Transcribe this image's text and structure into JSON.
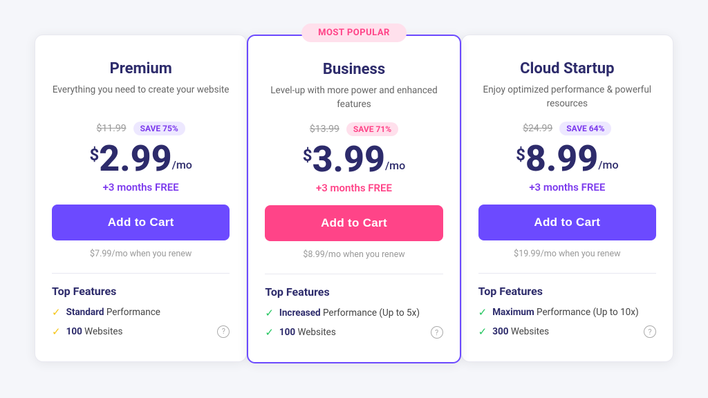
{
  "page": {
    "background": "#f5f6fa"
  },
  "plans": [
    {
      "id": "premium",
      "title": "Premium",
      "description": "Everything you need to create your website",
      "featured": false,
      "mostPopularLabel": "",
      "originalPrice": "$11.99",
      "saveBadge": "SAVE 75%",
      "saveBadgeStyle": "purple",
      "priceAmount": "2.99",
      "pricePeriod": "/mo",
      "freeMonths": "+3 months FREE",
      "freeMonthsStyle": "purple",
      "addToCartLabel": "Add to Cart",
      "addToCartStyle": "purple",
      "renewText": "$7.99/mo when you renew",
      "topFeaturesTitle": "Top Features",
      "features": [
        {
          "bold": "Standard",
          "rest": " Performance",
          "checkStyle": "yellow",
          "hasInfo": false
        },
        {
          "bold": "100",
          "rest": " Websites",
          "checkStyle": "yellow",
          "hasInfo": true
        }
      ]
    },
    {
      "id": "business",
      "title": "Business",
      "description": "Level-up with more power and enhanced features",
      "featured": true,
      "mostPopularLabel": "MOST POPULAR",
      "originalPrice": "$13.99",
      "saveBadge": "SAVE 71%",
      "saveBadgeStyle": "pink",
      "priceAmount": "3.99",
      "pricePeriod": "/mo",
      "freeMonths": "+3 months FREE",
      "freeMonthsStyle": "pink",
      "addToCartLabel": "Add to Cart",
      "addToCartStyle": "pink",
      "renewText": "$8.99/mo when you renew",
      "topFeaturesTitle": "Top Features",
      "features": [
        {
          "bold": "Increased",
          "rest": " Performance (Up to 5x)",
          "checkStyle": "green",
          "hasInfo": false
        },
        {
          "bold": "100",
          "rest": " Websites",
          "checkStyle": "green",
          "hasInfo": true
        }
      ]
    },
    {
      "id": "cloud-startup",
      "title": "Cloud Startup",
      "description": "Enjoy optimized performance & powerful resources",
      "featured": false,
      "mostPopularLabel": "",
      "originalPrice": "$24.99",
      "saveBadge": "SAVE 64%",
      "saveBadgeStyle": "purple",
      "priceAmount": "8.99",
      "pricePeriod": "/mo",
      "freeMonths": "+3 months FREE",
      "freeMonthsStyle": "purple",
      "addToCartLabel": "Add to Cart",
      "addToCartStyle": "purple",
      "renewText": "$19.99/mo when you renew",
      "topFeaturesTitle": "Top Features",
      "features": [
        {
          "bold": "Maximum",
          "rest": " Performance (Up to 10x)",
          "checkStyle": "green",
          "hasInfo": false
        },
        {
          "bold": "300",
          "rest": " Websites",
          "checkStyle": "green",
          "hasInfo": true
        }
      ]
    }
  ]
}
